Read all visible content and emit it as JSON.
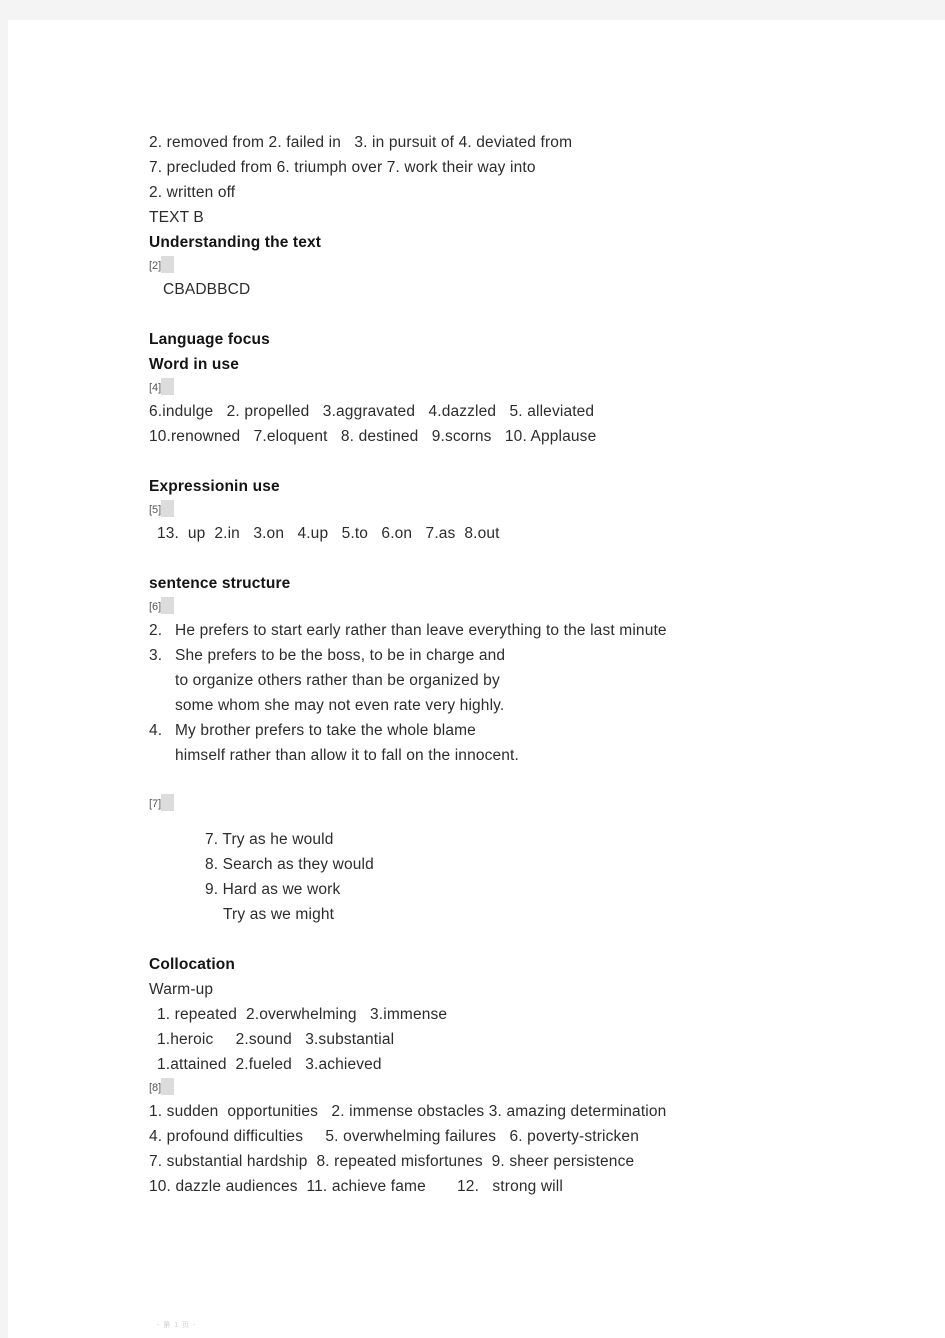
{
  "document": {
    "footer_mark": "- 第 1 页 -",
    "sections": [
      {
        "id": "answer-key-top",
        "lines": [
          "2. removed from 2. failed in   3. in pursuit of 4. deviated from",
          "7. precluded from 6. triumph over 7. work their way into",
          "2. written off",
          "TEXT B"
        ]
      },
      {
        "id": "understanding-the-text",
        "heading": "Understanding the text",
        "marker": "[2]",
        "answer": "CBADBBCD"
      },
      {
        "id": "language-focus",
        "heading": "Language focus",
        "subheading": "Word in use",
        "marker": "[4]",
        "lines": [
          "6.indulge   2. propelled   3.aggravated   4.dazzled   5. alleviated",
          "10.renowned   7.eloquent   8. destined   9.scorns   10. Applause"
        ]
      },
      {
        "id": "expression-in-use",
        "heading": "Expressionin use",
        "marker": "[5]",
        "lines": [
          "13.  up  2.in   3.on   4.up   5.to   6.on   7.as  8.out"
        ]
      },
      {
        "id": "sentence-structure",
        "heading": "sentence structure",
        "marker": "[6]",
        "items": [
          {
            "num": "2.",
            "lines": [
              "He prefers to start early rather than leave everything to the last minute"
            ]
          },
          {
            "num": "3.",
            "lines": [
              "She prefers to be the boss, to be in charge and",
              "to organize others rather than be organized by",
              "some whom she may not even rate very highly."
            ]
          },
          {
            "num": "4.",
            "lines": [
              "My brother prefers to take the whole blame",
              "himself rather than allow it to fall on the innocent."
            ]
          }
        ]
      },
      {
        "id": "sentence-structure-7",
        "marker": "[7]",
        "lines": [
          "7. Try as he would",
          "8. Search as they would",
          "9. Hard as we work",
          "Try as we might"
        ]
      },
      {
        "id": "collocation",
        "heading": "Collocation",
        "subheading": "Warm-up",
        "warmup_lines": [
          "1. repeated  2.overwhelming   3.immense",
          "1.heroic     2.sound   3.substantial",
          "1.attained  2.fueled   3.achieved"
        ],
        "marker": "[8]",
        "lines": [
          "1. sudden  opportunities   2. immense obstacles 3. amazing determination",
          "4. profound difficulties     5. overwhelming failures   6. poverty-stricken",
          "7. substantial hardship  8. repeated misfortunes  9. sheer persistence",
          "10. dazzle audiences  11. achieve fame       12.   strong will"
        ]
      }
    ]
  }
}
